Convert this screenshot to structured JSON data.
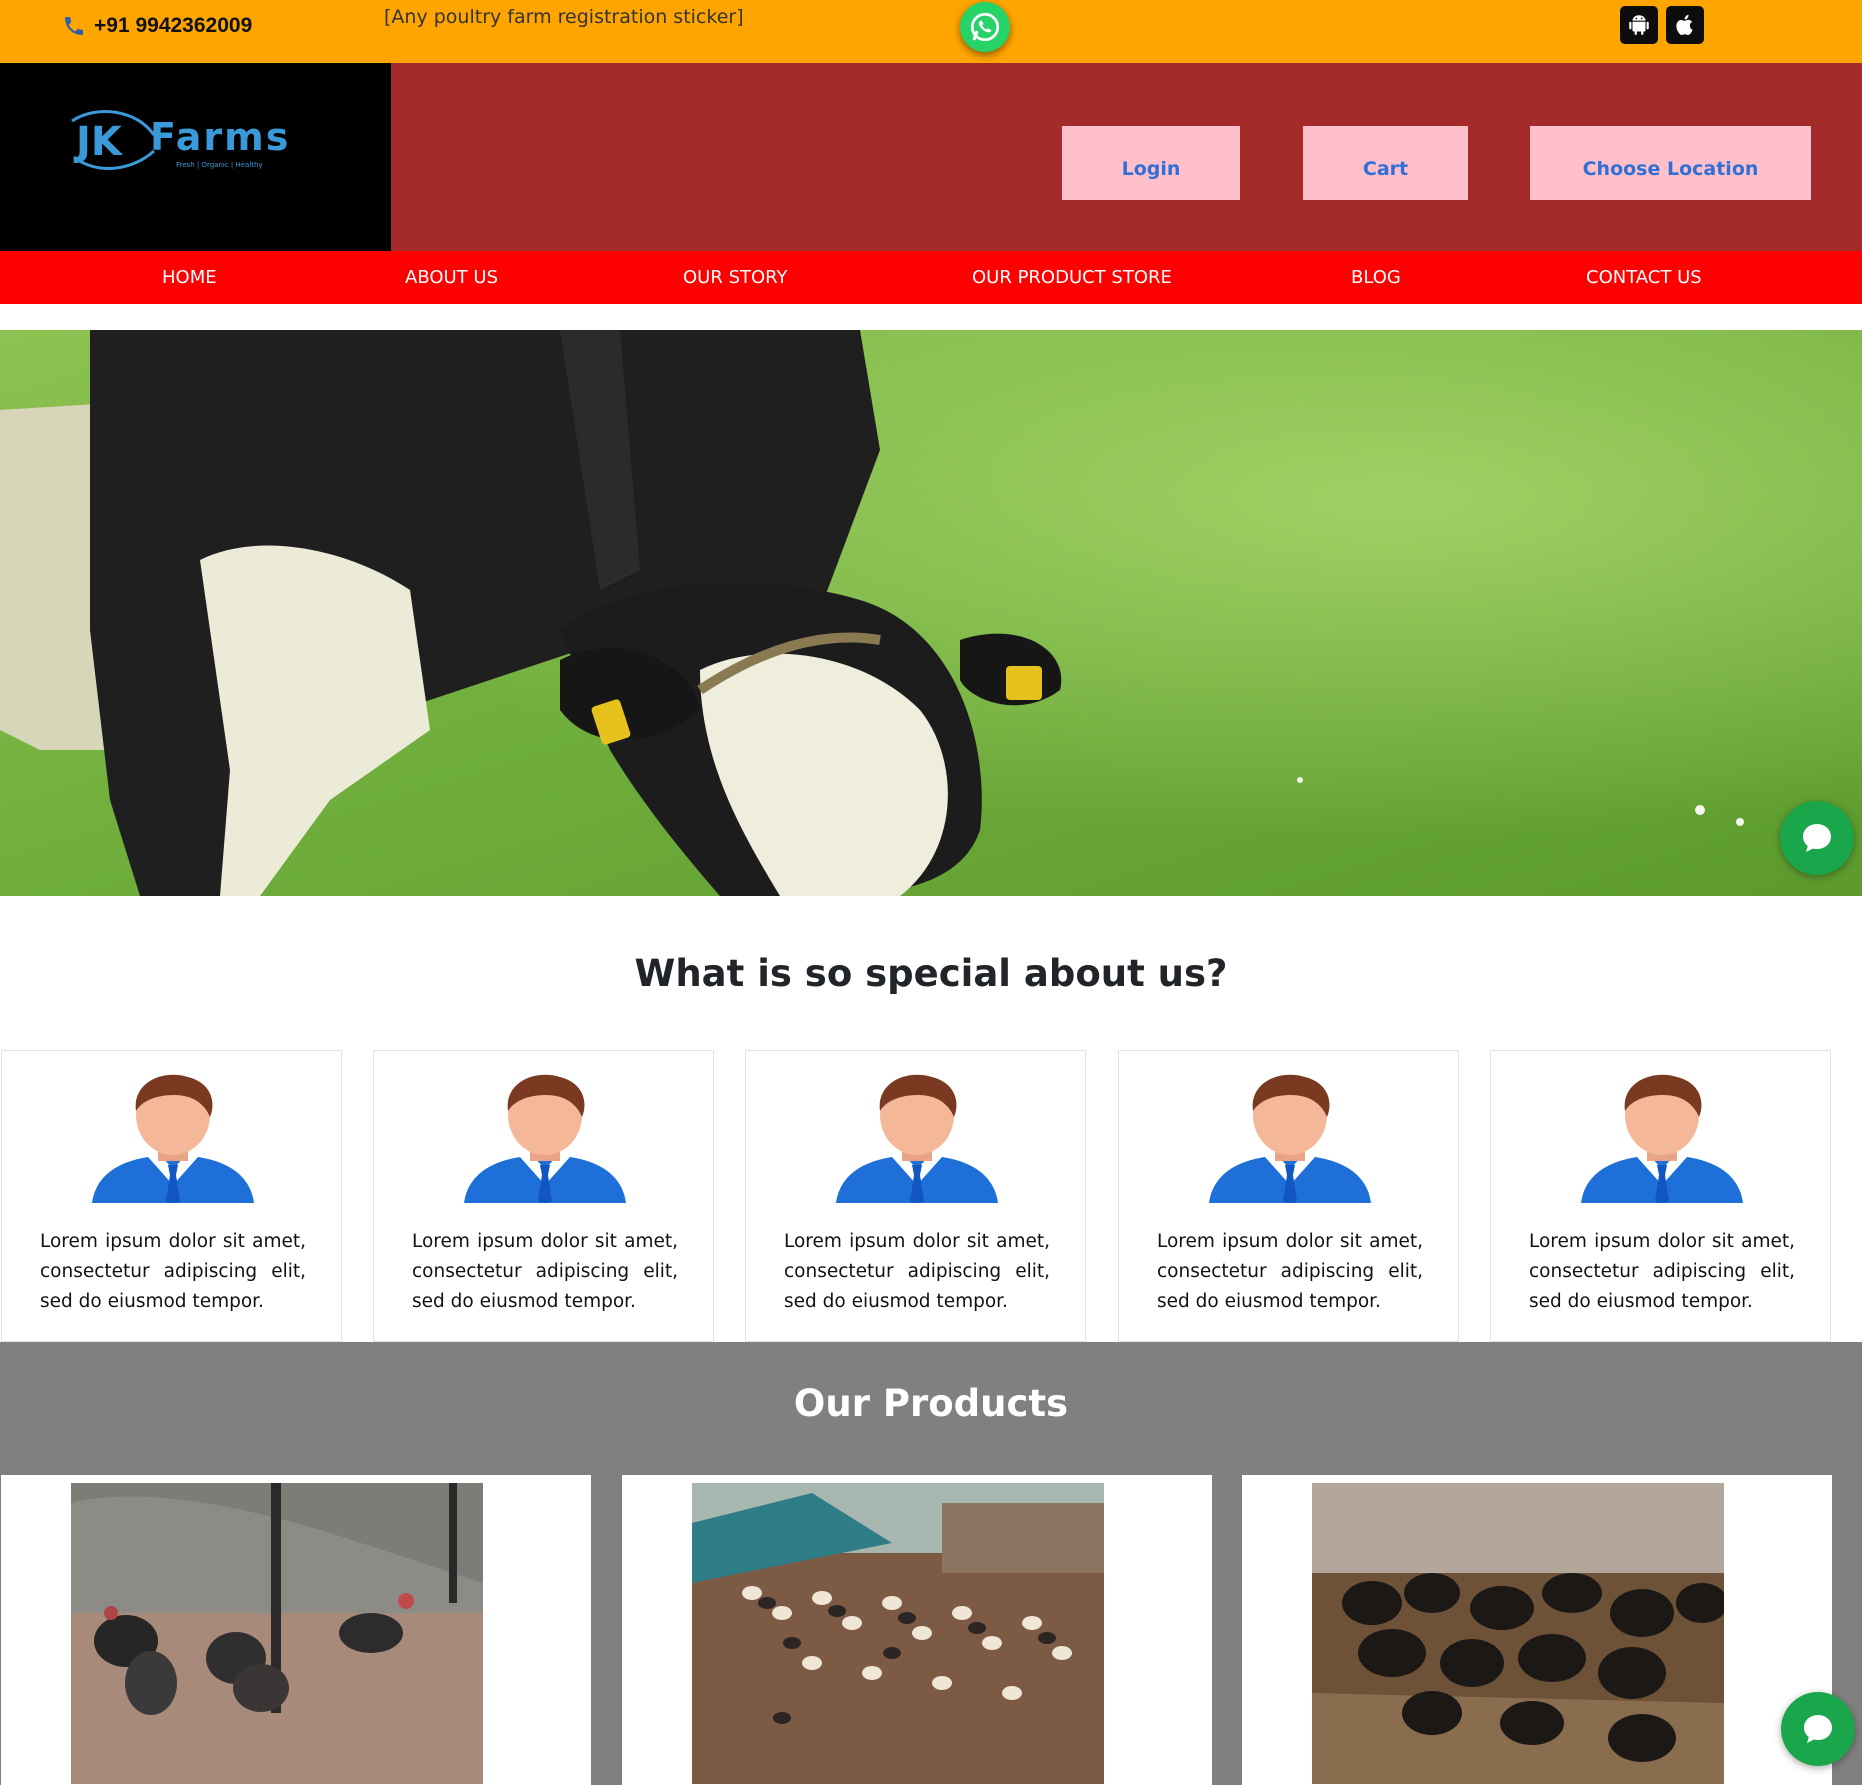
{
  "topbar": {
    "phone": "+91 9942362009",
    "sticker": "[Any poultry farm registration sticker]",
    "icons": [
      "phone-icon",
      "whatsapp-icon",
      "android-icon",
      "apple-icon"
    ],
    "background": "#ffa500"
  },
  "header": {
    "brand_main": "Farms",
    "brand_tagline": "Fresh | Organic | Healthy",
    "login_label": "Login",
    "cart_label": "Cart",
    "location_label": "Choose Location",
    "background": "#a52a2a",
    "button_color": "#ffc0cb",
    "button_text_color": "#2f6fd6"
  },
  "nav": {
    "items": [
      {
        "label": "HOME"
      },
      {
        "label": "ABOUT US"
      },
      {
        "label": "OUR STORY"
      },
      {
        "label": "OUR PRODUCT STORE"
      },
      {
        "label": "BLOG"
      },
      {
        "label": "CONTACT US"
      }
    ],
    "background": "#ff0000"
  },
  "special": {
    "title": "What is so special about us?",
    "cards": [
      {
        "text": "Lorem ipsum dolor sit amet, consectetur adipiscing elit, sed do eiusmod tempor."
      },
      {
        "text": "Lorem ipsum dolor sit amet, consectetur adipiscing elit, sed do eiusmod tempor."
      },
      {
        "text": "Lorem ipsum dolor sit amet, consectetur adipiscing elit, sed do eiusmod tempor."
      },
      {
        "text": "Lorem ipsum dolor sit amet, consectetur adipiscing elit, sed do eiusmod tempor."
      },
      {
        "text": "Lorem ipsum dolor sit amet, consectetur adipiscing elit, sed do eiusmod tempor."
      }
    ]
  },
  "products": {
    "title": "Our Products",
    "background": "#808080"
  },
  "chat": {
    "icon": "chat-bubble-icon",
    "color": "#1aa64a"
  }
}
